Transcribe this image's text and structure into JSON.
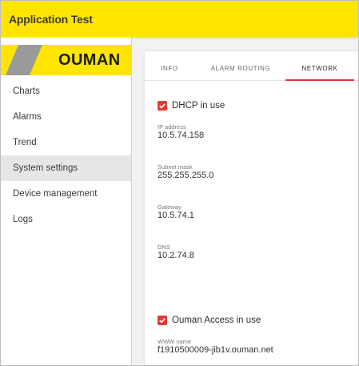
{
  "header": {
    "title": "Application Test"
  },
  "logo": {
    "text": "OUMAN"
  },
  "sidebar": {
    "items": [
      {
        "label": "Charts",
        "active": false
      },
      {
        "label": "Alarms",
        "active": false
      },
      {
        "label": "Trend",
        "active": false
      },
      {
        "label": "System settings",
        "active": true
      },
      {
        "label": "Device management",
        "active": false
      },
      {
        "label": "Logs",
        "active": false
      }
    ]
  },
  "tabs": [
    {
      "label": "INFO",
      "active": false
    },
    {
      "label": "ALARM ROUTING",
      "active": false
    },
    {
      "label": "NETWORK",
      "active": true
    }
  ],
  "network": {
    "dhcp": {
      "label": "DHCP in use",
      "checked": true
    },
    "ip": {
      "label": "IP address",
      "value": "10.5.74.158"
    },
    "subnet": {
      "label": "Subnet mask",
      "value": "255.255.255.0"
    },
    "gateway": {
      "label": "Gateway",
      "value": "10.5.74.1"
    },
    "dns": {
      "label": "DNS",
      "value": "10.2.74.8"
    },
    "ouman_access": {
      "label": "Ouman Access in use",
      "checked": true
    },
    "www": {
      "label": "WWW name",
      "value": "f1910500009-jib1v.ouman.net"
    }
  },
  "colors": {
    "brand_yellow": "#ffe500",
    "accent_red": "#e53935",
    "active_nav": "#e6e6e6"
  }
}
